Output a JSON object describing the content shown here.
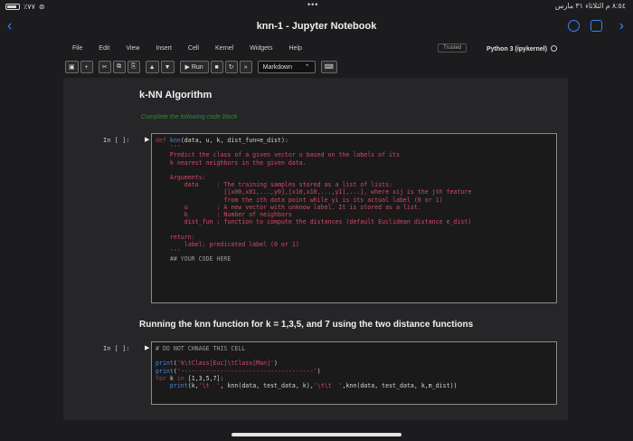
{
  "status": {
    "left_text": "٪٧٧",
    "right_text": "٨:٥٤ م الثلاثاء ٣١ مارس",
    "dots": "•••"
  },
  "nav": {
    "title": "knn-1 - Jupyter Notebook"
  },
  "menu": {
    "items": [
      "File",
      "Edit",
      "View",
      "Insert",
      "Cell",
      "Kernel",
      "Widgets",
      "Help"
    ],
    "trusted": "Trusted",
    "kernel": "Python 3 (ipykernel)"
  },
  "toolbar": {
    "run_label": "▶ Run",
    "cell_type": "Markdown"
  },
  "cells": {
    "heading": "k-NN Algorithm",
    "instruction": "Complete the following code block",
    "prompt1": "In [ ]:",
    "prompt2": "In [ ]:",
    "section_title": "Running the knn function for k = 1,3,5, and 7 using the two distance functions"
  }
}
